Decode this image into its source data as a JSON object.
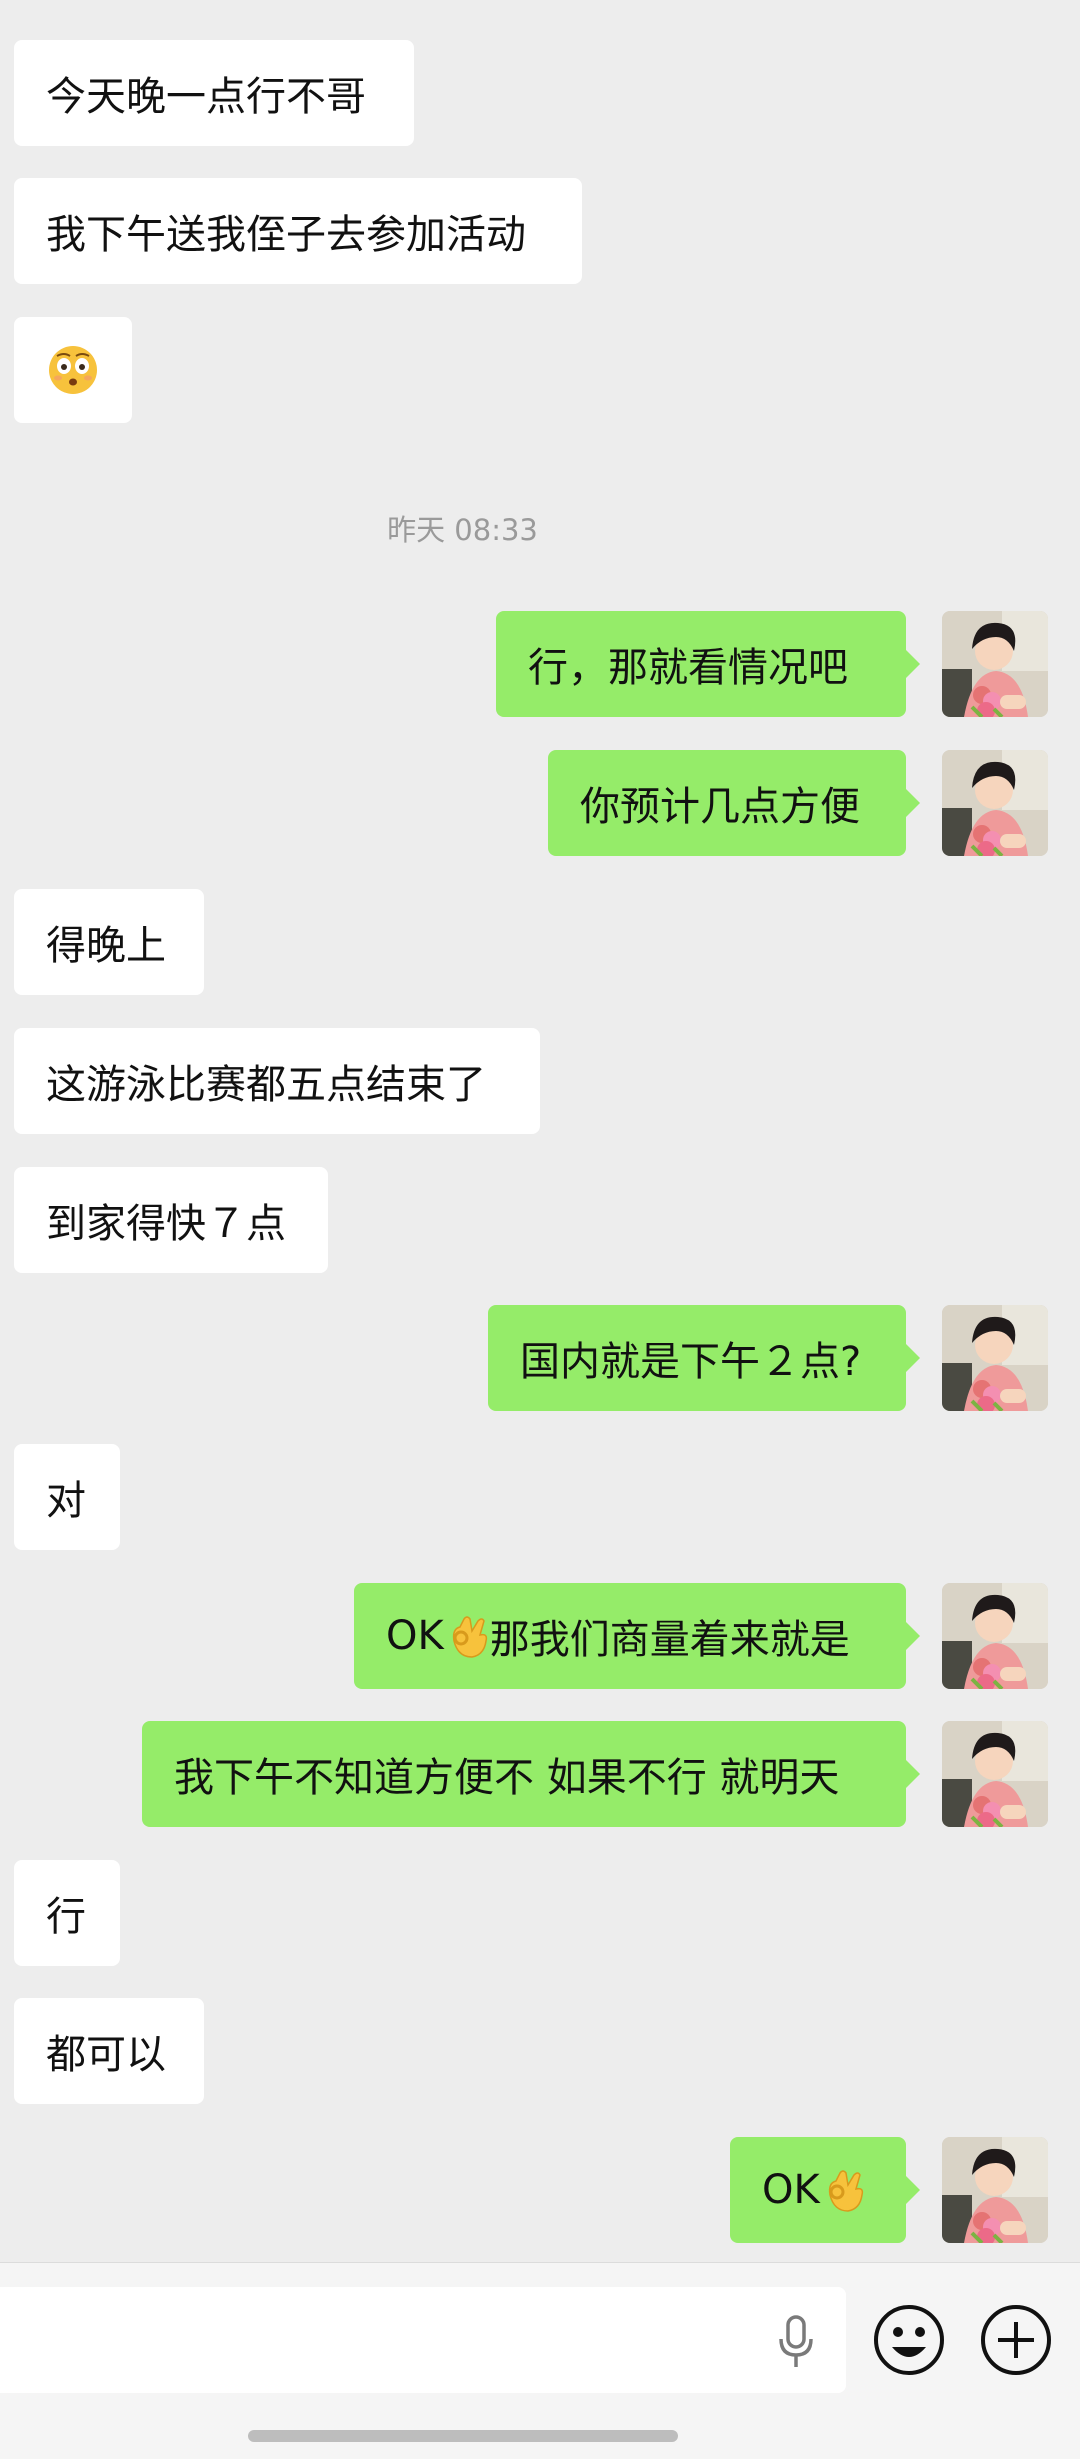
{
  "chat": {
    "timestamp": "昨天 08:33",
    "messages": [
      {
        "side": "in",
        "text": "今天晚一点行不哥"
      },
      {
        "side": "in",
        "text": "我下午送我侄子去参加活动"
      },
      {
        "side": "in",
        "emoji": "flushed-face-emoji"
      },
      {
        "side": "out",
        "text": "行，那就看情况吧"
      },
      {
        "side": "out",
        "text": "你预计几点方便"
      },
      {
        "side": "in",
        "text": "得晚上"
      },
      {
        "side": "in",
        "text": "这游泳比赛都五点结束了"
      },
      {
        "side": "in",
        "text": "到家得快７点"
      },
      {
        "side": "out",
        "text": "国内就是下午２点?"
      },
      {
        "side": "in",
        "text": "对"
      },
      {
        "side": "out",
        "prefix": "OK",
        "emoji": "ok-hand-emoji",
        "text": "那我们商量着来就是"
      },
      {
        "side": "out",
        "text": "我下午不知道方便不  如果不行 就明天"
      },
      {
        "side": "in",
        "text": "行"
      },
      {
        "side": "in",
        "text": "都可以"
      },
      {
        "side": "out",
        "prefix": "OK",
        "emoji": "ok-hand-emoji"
      }
    ]
  },
  "colors": {
    "background": "#ededed",
    "incoming_bubble": "#ffffff",
    "outgoing_bubble": "#95ec69",
    "timestamp_text": "#9a9a9a"
  },
  "input_bar": {
    "value": "",
    "icons": [
      "microphone-icon",
      "emoji-icon",
      "plus-icon"
    ]
  }
}
